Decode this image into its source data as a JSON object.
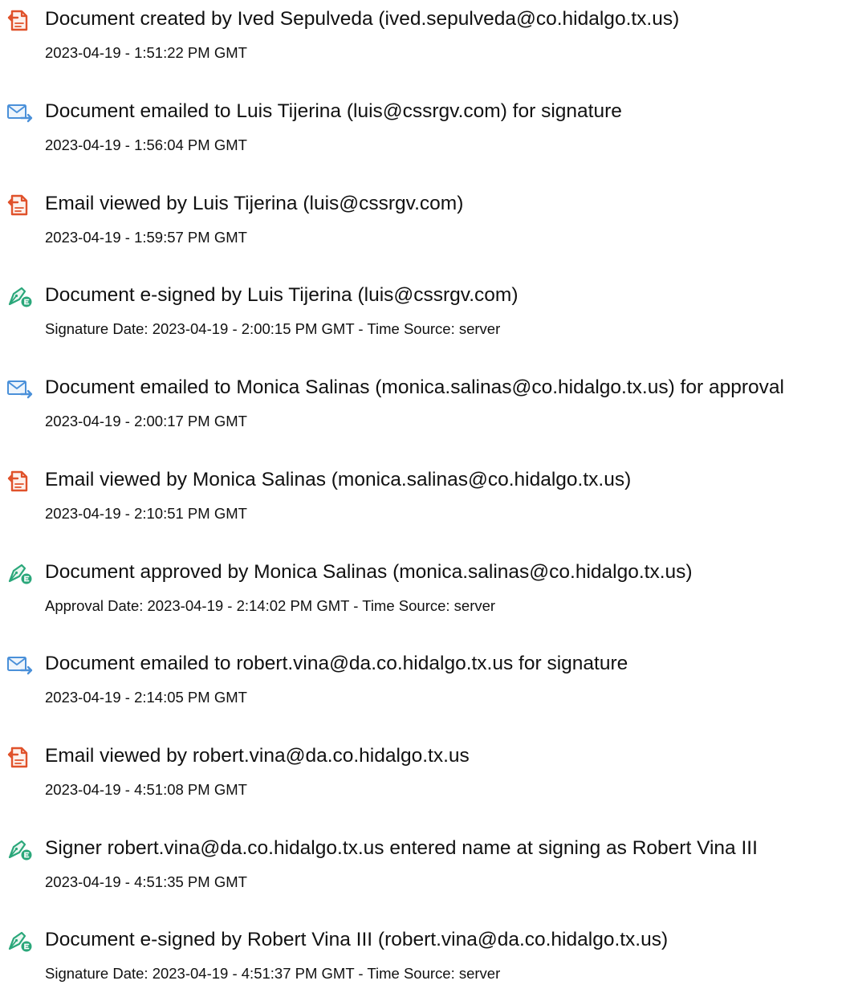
{
  "colors": {
    "document_icon": "#e0522b",
    "email_icon": "#4a90d9",
    "sign_icon": "#2aa77a"
  },
  "events": [
    {
      "icon": "document-icon",
      "title": "Document created by Ived Sepulveda (ived.sepulveda@co.hidalgo.tx.us)",
      "detail": "2023-04-19 - 1:51:22 PM GMT"
    },
    {
      "icon": "email-sent-icon",
      "title": "Document emailed to Luis Tijerina (luis@cssrgv.com) for signature",
      "detail": "2023-04-19 - 1:56:04 PM GMT"
    },
    {
      "icon": "document-icon",
      "title": "Email viewed by Luis Tijerina (luis@cssrgv.com)",
      "detail": "2023-04-19 - 1:59:57 PM GMT"
    },
    {
      "icon": "esign-pen-icon",
      "title": "Document e-signed by Luis Tijerina (luis@cssrgv.com)",
      "detail": "Signature Date: 2023-04-19 - 2:00:15 PM GMT - Time Source: server"
    },
    {
      "icon": "email-sent-icon",
      "title": "Document emailed to Monica Salinas (monica.salinas@co.hidalgo.tx.us) for approval",
      "detail": "2023-04-19 - 2:00:17 PM GMT"
    },
    {
      "icon": "document-icon",
      "title": "Email viewed by Monica Salinas (monica.salinas@co.hidalgo.tx.us)",
      "detail": "2023-04-19 - 2:10:51 PM GMT"
    },
    {
      "icon": "esign-pen-icon",
      "title": "Document approved by Monica Salinas (monica.salinas@co.hidalgo.tx.us)",
      "detail": "Approval Date: 2023-04-19 - 2:14:02 PM GMT - Time Source: server"
    },
    {
      "icon": "email-sent-icon",
      "title": "Document emailed to robert.vina@da.co.hidalgo.tx.us for signature",
      "detail": "2023-04-19 - 2:14:05 PM GMT"
    },
    {
      "icon": "document-icon",
      "title": "Email viewed by robert.vina@da.co.hidalgo.tx.us",
      "detail": "2023-04-19 - 4:51:08 PM GMT"
    },
    {
      "icon": "esign-pen-icon",
      "title": "Signer robert.vina@da.co.hidalgo.tx.us entered name at signing as Robert Vina III",
      "detail": "2023-04-19 - 4:51:35 PM GMT"
    },
    {
      "icon": "esign-pen-icon",
      "title": "Document e-signed by Robert Vina III (robert.vina@da.co.hidalgo.tx.us)",
      "detail": "Signature Date: 2023-04-19 - 4:51:37 PM GMT - Time Source: server"
    }
  ]
}
